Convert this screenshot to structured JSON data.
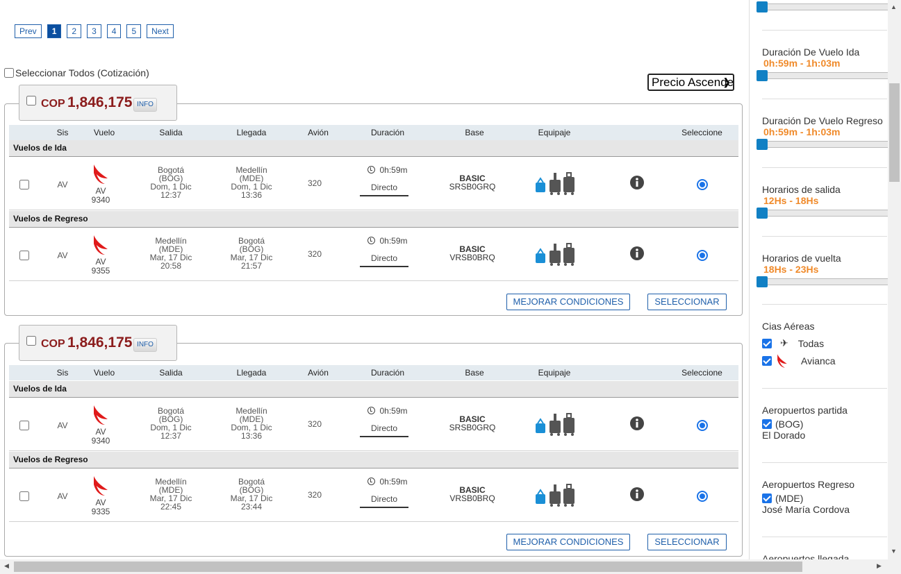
{
  "pagination": {
    "prev": "Prev",
    "pages": [
      "1",
      "2",
      "3",
      "4",
      "5"
    ],
    "next": "Next"
  },
  "select_all": "Seleccionar Todos (Cotización)",
  "sort_selected": "Precio Ascendente",
  "columns": [
    "Sis",
    "Vuelo",
    "Salida",
    "Llegada",
    "Avión",
    "Duración",
    "Base",
    "Equipaje",
    "Seleccione"
  ],
  "sections": {
    "ida": "Vuelos de Ida",
    "regreso": "Vuelos de Regreso"
  },
  "buttons": {
    "mejorar": "MEJORAR CONDICIONES",
    "seleccionar": "SELECCIONAR"
  },
  "results": [
    {
      "currency": "COP",
      "price": "1,846,175",
      "info": "INFO",
      "ida": {
        "sis": "AV",
        "airline": "AV",
        "flight": "9340",
        "dep_city": "Bogotá",
        "dep_code": "(BOG)",
        "dep_date": "Dom, 1 Dic",
        "dep_time": "12:37",
        "arr_city": "Medellín",
        "arr_code": "(MDE)",
        "arr_date": "Dom, 1 Dic",
        "arr_time": "13:36",
        "plane": "320",
        "duration": "0h:59m",
        "stops": "Directo",
        "base": "BASIC",
        "fare": "SRSB0GRQ"
      },
      "regreso": {
        "sis": "AV",
        "airline": "AV",
        "flight": "9355",
        "dep_city": "Medellín",
        "dep_code": "(MDE)",
        "dep_date": "Mar, 17 Dic",
        "dep_time": "20:58",
        "arr_city": "Bogotá",
        "arr_code": "(BOG)",
        "arr_date": "Mar, 17 Dic",
        "arr_time": "21:57",
        "plane": "320",
        "duration": "0h:59m",
        "stops": "Directo",
        "base": "BASIC",
        "fare": "VRSB0BRQ"
      }
    },
    {
      "currency": "COP",
      "price": "1,846,175",
      "info": "INFO",
      "ida": {
        "sis": "AV",
        "airline": "AV",
        "flight": "9340",
        "dep_city": "Bogotá",
        "dep_code": "(BOG)",
        "dep_date": "Dom, 1 Dic",
        "dep_time": "12:37",
        "arr_city": "Medellín",
        "arr_code": "(MDE)",
        "arr_date": "Dom, 1 Dic",
        "arr_time": "13:36",
        "plane": "320",
        "duration": "0h:59m",
        "stops": "Directo",
        "base": "BASIC",
        "fare": "SRSB0GRQ"
      },
      "regreso": {
        "sis": "AV",
        "airline": "AV",
        "flight": "9335",
        "dep_city": "Medellín",
        "dep_code": "(MDE)",
        "dep_date": "Mar, 17 Dic",
        "dep_time": "22:45",
        "arr_city": "Bogotá",
        "arr_code": "(BOG)",
        "arr_date": "Mar, 17 Dic",
        "arr_time": "23:44",
        "plane": "320",
        "duration": "0h:59m",
        "stops": "Directo",
        "base": "BASIC",
        "fare": "VRSB0BRQ"
      }
    }
  ],
  "filters": {
    "dur_ida": {
      "title": "Duración De Vuelo Ida",
      "value": "0h:59m - 1h:03m"
    },
    "dur_regreso": {
      "title": "Duración De Vuelo Regreso",
      "value": "0h:59m - 1h:03m"
    },
    "salida": {
      "title": "Horarios de salida",
      "value": "12Hs - 18Hs"
    },
    "vuelta": {
      "title": "Horarios de vuelta",
      "value": "18Hs - 23Hs"
    },
    "cias": {
      "title": "Cias Aéreas",
      "todas": "Todas",
      "avianca": "Avianca"
    },
    "aero_partida": {
      "title": "Aeropuertos partida",
      "code": "(BOG)",
      "name": "El Dorado"
    },
    "aero_regreso": {
      "title": "Aeropuertos Regreso",
      "code": "(MDE)",
      "name": "José María Cordova"
    },
    "aero_llegada": {
      "title": "Aeropuertos llegada"
    }
  },
  "colors": {
    "price": "#8b1c1c",
    "accent": "#1f5faa",
    "filter_value": "#f08a2a",
    "slider": "#1180c4"
  }
}
